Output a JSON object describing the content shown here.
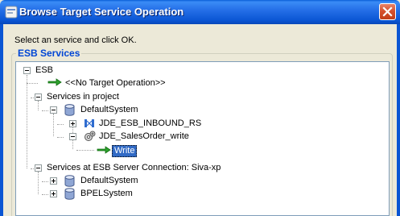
{
  "window": {
    "title": "Browse Target Service Operation",
    "close_label": "Close"
  },
  "prompt": "Select an service and click OK.",
  "group": {
    "title": "ESB Services"
  },
  "tree": {
    "root": {
      "label": "ESB",
      "expanded": true
    },
    "no_target": {
      "label": "<<No Target Operation>>",
      "icon": "green-arrow-icon"
    },
    "services_in_project": {
      "label": "Services in project",
      "expanded": true
    },
    "default_system": {
      "label": "DefaultSystem",
      "icon": "database-icon",
      "expanded": true
    },
    "jde_inbound": {
      "label": "JDE_ESB_INBOUND_RS",
      "icon": "routing-service-icon",
      "expanded": false
    },
    "jde_salesorder": {
      "label": "JDE_SalesOrder_write",
      "icon": "adapter-gear-icon",
      "expanded": true
    },
    "write": {
      "label": "Write",
      "icon": "green-arrow-icon",
      "selected": true
    },
    "services_at_server": {
      "label": "Services at ESB Server Connection: Siva-xp",
      "expanded": true
    },
    "server_default_system": {
      "label": "DefaultSystem",
      "icon": "database-icon",
      "expanded": false
    },
    "bpel_system": {
      "label": "BPELSystem",
      "icon": "database-icon",
      "expanded": false
    }
  },
  "colors": {
    "titlebar": "#0a55d3",
    "group_title": "#0046d5",
    "selection": "#316ac5",
    "dialog_bg": "#ece9d8"
  }
}
